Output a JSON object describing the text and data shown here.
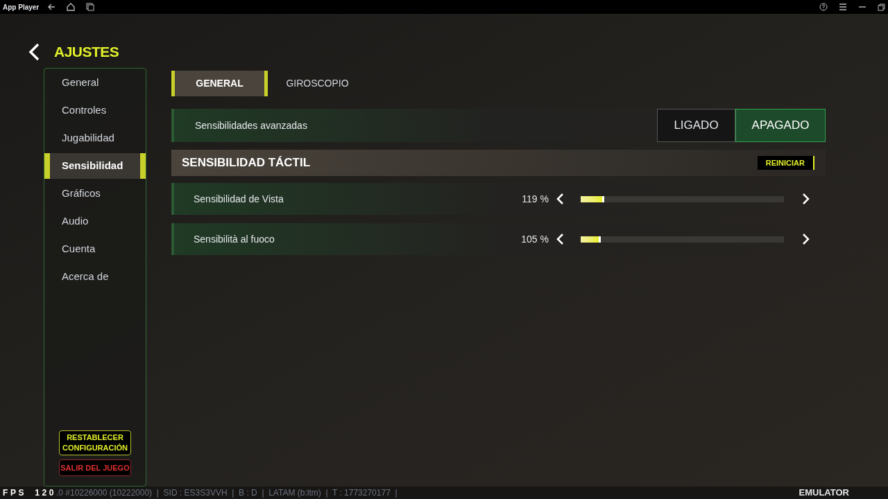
{
  "window": {
    "title": "App Player"
  },
  "header": {
    "title": "AJUSTES"
  },
  "sidebar": {
    "items": [
      {
        "label": "General",
        "selected": false
      },
      {
        "label": "Controles",
        "selected": false
      },
      {
        "label": "Jugabilidad",
        "selected": false
      },
      {
        "label": "Sensibilidad",
        "selected": true
      },
      {
        "label": "Gráficos",
        "selected": false
      },
      {
        "label": "Audio",
        "selected": false
      },
      {
        "label": "Cuenta",
        "selected": false
      },
      {
        "label": "Acerca de",
        "selected": false
      }
    ],
    "buttons": [
      {
        "label": "RESTABLECER CONFIGURACIÓN",
        "kind": "reset"
      },
      {
        "label": "SALIR DEL JUEGO",
        "kind": "exit"
      }
    ]
  },
  "tabs": [
    {
      "label": "GENERAL",
      "selected": true
    },
    {
      "label": "GIROSCOPIO",
      "selected": false
    }
  ],
  "advanced": {
    "label": "Sensibilidades avanzadas",
    "options": [
      {
        "label": "LIGADO",
        "selected": false
      },
      {
        "label": "APAGADO",
        "selected": true
      }
    ]
  },
  "section": {
    "title": "SENSIBILIDAD TÁCTIL",
    "button": "REINICIAR"
  },
  "sliders": [
    {
      "label": "Sensibilidad de Vista",
      "reading": "119 %",
      "level": 0.116
    },
    {
      "label": "Sensibilità al fuoco",
      "reading": "105 %",
      "level": 0.1
    }
  ],
  "status_bar": {
    "fps_label": "FPS",
    "fps": "120",
    "info": ".0 #10226000 (10222000)  |  SID : ES3S3VVH  |  B : D  |  LATAM (b:ltm)  |  T : 1773270177  |",
    "brand": "EMULATOR"
  }
}
